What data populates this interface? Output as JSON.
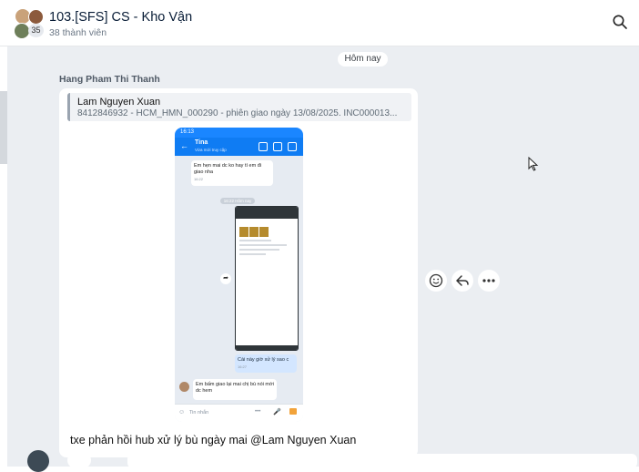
{
  "header": {
    "title": "103.[SFS] CS - Kho Vận",
    "members": "38 thành viên",
    "avatar_count": "35",
    "search_icon": "search-icon"
  },
  "chat": {
    "date_chip": "Hôm nay",
    "sender": "Hang Pham Thi Thanh",
    "quote": {
      "name": "Lam Nguyen Xuan",
      "text": "8412846932 - HCM_HMN_000290 - phiên giao ngày 13/08/2025. INC000013..."
    },
    "caption": "txe phản hồi hub xử lý bù ngày mai @Lam Nguyen Xuan",
    "actions": [
      "emoji-icon",
      "reply-icon",
      "more-icon"
    ]
  },
  "embedded_screenshot": {
    "status_time": "16:13",
    "contact_name": "Tina",
    "contact_status": "Vừa mới truy cập",
    "msg1": "Em hẹn mai dc ko hay tí em đi giao nha",
    "msg1_time": "16:22",
    "date_divider": "16:22 Hôm nay",
    "msg_blue": "Cái này giờ xử lý sao c",
    "msg_blue_time": "16:27",
    "msg_recv": "Em bấm giao lại mai chị bù nói mới dc hem",
    "input_placeholder": "Tin nhắn"
  },
  "colors": {
    "accent": "#0f7cf3",
    "chat_bg": "#ebeef2",
    "bubble": "#ffffff"
  }
}
